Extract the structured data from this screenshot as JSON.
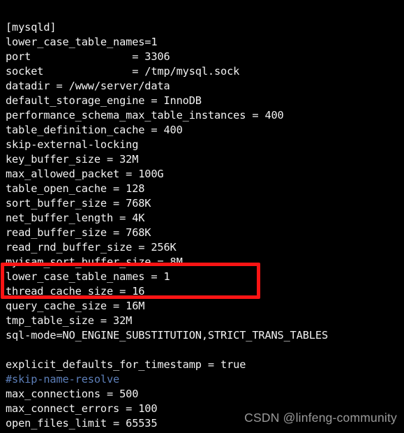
{
  "window": {
    "kind": "terminal-text-editor",
    "background_color": "#000000",
    "foreground_color": "#f2f2f2",
    "comment_color": "#5d7fb9",
    "highlight_color": "#fb1414"
  },
  "file": {
    "section": "[mysqld]",
    "lines": [
      {
        "text": "[mysqld]",
        "style": "normal"
      },
      {
        "text": "lower_case_table_names=1",
        "style": "normal"
      },
      {
        "text": "port                = 3306",
        "style": "normal"
      },
      {
        "text": "socket              = /tmp/mysql.sock",
        "style": "normal"
      },
      {
        "text": "datadir = /www/server/data",
        "style": "normal"
      },
      {
        "text": "default_storage_engine = InnoDB",
        "style": "normal"
      },
      {
        "text": "performance_schema_max_table_instances = 400",
        "style": "normal"
      },
      {
        "text": "table_definition_cache = 400",
        "style": "normal"
      },
      {
        "text": "skip-external-locking",
        "style": "normal"
      },
      {
        "text": "key_buffer_size = 32M",
        "style": "normal"
      },
      {
        "text": "max_allowed_packet = 100G",
        "style": "normal"
      },
      {
        "text": "table_open_cache = 128",
        "style": "normal"
      },
      {
        "text": "sort_buffer_size = 768K",
        "style": "normal"
      },
      {
        "text": "net_buffer_length = 4K",
        "style": "normal"
      },
      {
        "text": "read_buffer_size = 768K",
        "style": "normal"
      },
      {
        "text": "read_rnd_buffer_size = 256K",
        "style": "normal"
      },
      {
        "text": "myisam_sort_buffer_size = 8M",
        "style": "normal"
      },
      {
        "text": "lower_case_table_names = 1",
        "style": "normal"
      },
      {
        "text": "thread_cache_size = 16",
        "style": "normal"
      },
      {
        "text": "query_cache_size = 16M",
        "style": "normal"
      },
      {
        "text": "tmp_table_size = 32M",
        "style": "normal"
      },
      {
        "text": "sql-mode=NO_ENGINE_SUBSTITUTION,STRICT_TRANS_TABLES",
        "style": "normal"
      },
      {
        "text": "",
        "style": "blank"
      },
      {
        "text": "explicit_defaults_for_timestamp = true",
        "style": "normal"
      },
      {
        "text": "#skip-name-resolve",
        "style": "comment"
      },
      {
        "text": "max_connections = 500",
        "style": "normal"
      },
      {
        "text": "max_connect_errors = 100",
        "style": "normal"
      },
      {
        "text": "open_files_limit = 65535",
        "style": "normal"
      }
    ]
  },
  "annotation": {
    "type": "red-rectangle-highlight",
    "covers_lines": [
      "lower_case_table_names = 1",
      "thread_cache_size = 16"
    ],
    "color": "#fb1414"
  },
  "watermark": {
    "text": "CSDN @linfeng-community"
  }
}
